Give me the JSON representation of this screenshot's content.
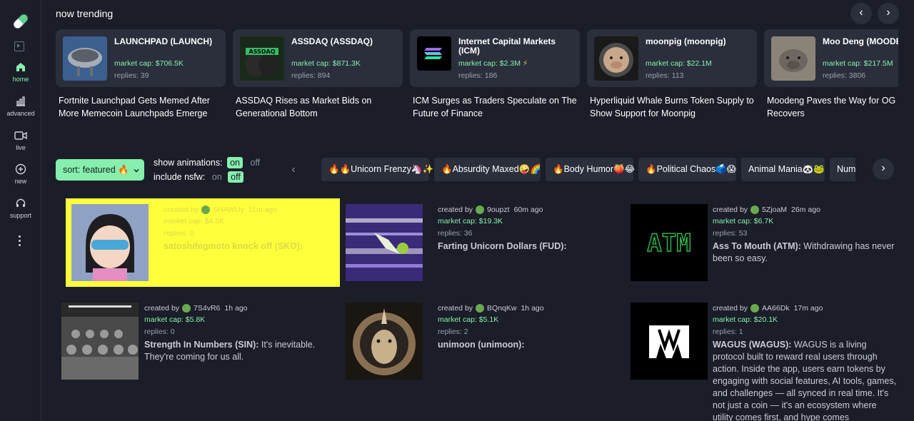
{
  "sidebar": {
    "items": [
      {
        "label": "home",
        "icon": "home-icon",
        "active": true
      },
      {
        "label": "advanced",
        "icon": "bar-chart-icon"
      },
      {
        "label": "live",
        "icon": "video-icon"
      },
      {
        "label": "new",
        "icon": "plus-circle-icon"
      },
      {
        "label": "support",
        "icon": "headset-icon"
      }
    ]
  },
  "trending": {
    "title": "now trending",
    "prev_icon": "chevron-left-icon",
    "next_icon": "chevron-right-icon",
    "cards": [
      {
        "name": "LAUNCHPAD (LAUNCH)",
        "market_cap": "market cap: $706.5K",
        "replies": "replies: 39",
        "headline": "Fortnite Launchpad Gets Memed After More Memecoin Launchpads Emerge"
      },
      {
        "name": "ASSDAQ (ASSDAQ)",
        "market_cap": "market cap: $871.3K",
        "replies": "replies: 894",
        "headline": "ASSDAQ Rises as Market Bids on Generational Bottom"
      },
      {
        "name": "Internet Capital Markets (ICM)",
        "market_cap": "market cap: $2.3M",
        "replies": "replies: 186",
        "headline": "ICM Surges as Traders Speculate on The Future of Finance",
        "badge": "⚡"
      },
      {
        "name": "moonpig (moonpig)",
        "market_cap": "market cap: $22.1M",
        "replies": "replies: 113",
        "headline": "Hyperliquid Whale Burns Token Supply to Show Support for Moonpig"
      },
      {
        "name": "Moo Deng (MOODENG)",
        "market_cap": "market cap: $217.5M",
        "replies": "replies: 3806",
        "headline": "Moodeng Paves the Way for OG C Market Recovers"
      }
    ]
  },
  "controls": {
    "sort_label": "sort: featured 🔥",
    "show_animations_label": "show animations:",
    "include_nsfw_label": "include nsfw:",
    "on": "on",
    "off": "off"
  },
  "categories": [
    "🔥🔥Unicorn Frenzy🦄✨",
    "🔥Absurdity Maxed🤪🌈",
    "🔥Body Humor🍑😂",
    "🔥Political Chaos🗳️😱",
    "Animal Mania🐼🐸",
    "Num"
  ],
  "coins": [
    {
      "created_by": "created by",
      "creator": "SHAWUy",
      "time": "11m ago",
      "market_cap": "market cap: $4.8K",
      "replies": "replies: 0",
      "title": "satoshibigmoto knock off (SKO):",
      "desc": ""
    },
    {
      "created_by": "created by",
      "creator": "9oupzt",
      "time": "60m ago",
      "market_cap": "market cap: $19.3K",
      "replies": "replies: 36",
      "title": "Farting Unicorn Dollars (FUD):",
      "desc": ""
    },
    {
      "created_by": "created by",
      "creator": "5ZjoaM",
      "time": "26m ago",
      "market_cap": "market cap: $6.7K",
      "replies": "replies: 53",
      "title": "Ass To Mouth (ATM):",
      "desc": " Withdrawing has never been so easy."
    },
    {
      "created_by": "created by",
      "creator": "7S4vR6",
      "time": "1h ago",
      "market_cap": "market cap: $5.8K",
      "replies": "replies: 0",
      "title": "Strength In Numbers (SIN):",
      "desc": " It's inevitable. They're coming for us all."
    },
    {
      "created_by": "created by",
      "creator": "BQnqKw",
      "time": "1h ago",
      "market_cap": "market cap: $5.1K",
      "replies": "replies: 2",
      "title": "unimoon (unimoon):",
      "desc": ""
    },
    {
      "created_by": "created by",
      "creator": "AA66Dk",
      "time": "17m ago",
      "market_cap": "market cap: $20.1K",
      "replies": "replies: 1",
      "title": "WAGUS (WAGUS):",
      "desc": " WAGUS is a living protocol built to reward real users through action. Inside the app, users earn tokens by engaging with social features, AI tools, games, and challenges — all synced in real time. It's not just a coin — it's an ecosystem where utility comes first, and hype comes"
    }
  ],
  "atm_logo_text": "ATM"
}
